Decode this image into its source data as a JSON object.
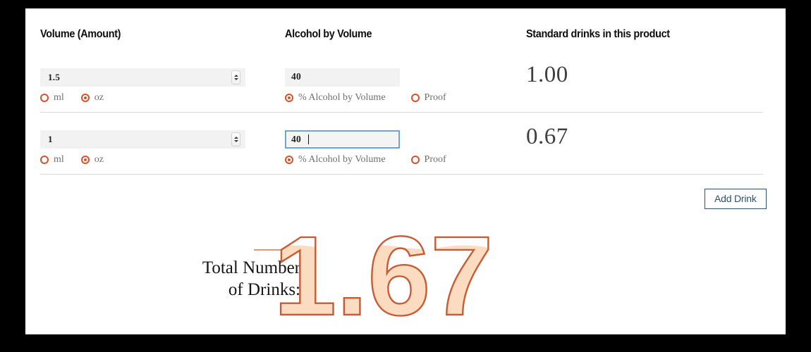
{
  "theme": {
    "page_background": "#000000",
    "card_background": "#ffffff",
    "accent_orange": "#d4522a",
    "fill_peach": "#fbdcc0",
    "button_blue": "#2e5266",
    "focus_blue": "#6ba3e0",
    "divider": "#d8d8d8",
    "rule_salmon": "#df9675"
  },
  "headers": {
    "volume": "Volume (Amount)",
    "abv": "Alcohol by Volume",
    "standard_drinks": "Standard drinks in this product"
  },
  "rows": [
    {
      "volume": {
        "value": "1.5",
        "spinner_icon": "number-spinner-icon",
        "units": [
          {
            "label": "ml",
            "selected": false
          },
          {
            "label": "oz",
            "selected": true
          }
        ]
      },
      "abv": {
        "value": "40",
        "focused": false,
        "caret": false,
        "units": [
          {
            "label": "% Alcohol by Volume",
            "selected": true
          },
          {
            "label": "Proof",
            "selected": false
          }
        ]
      },
      "standard_drinks": "1.00"
    },
    {
      "volume": {
        "value": "1",
        "spinner_icon": "number-spinner-icon",
        "units": [
          {
            "label": "ml",
            "selected": false
          },
          {
            "label": "oz",
            "selected": true
          }
        ]
      },
      "abv": {
        "value": "40",
        "focused": true,
        "caret": true,
        "units": [
          {
            "label": "% Alcohol by Volume",
            "selected": true
          },
          {
            "label": "Proof",
            "selected": false
          }
        ]
      },
      "standard_drinks": "0.67"
    }
  ],
  "actions": {
    "add_drink_label": "Add Drink"
  },
  "total": {
    "label": "Total Number\nof Drinks:",
    "value": "1.67",
    "fill_level_percent": 78
  }
}
